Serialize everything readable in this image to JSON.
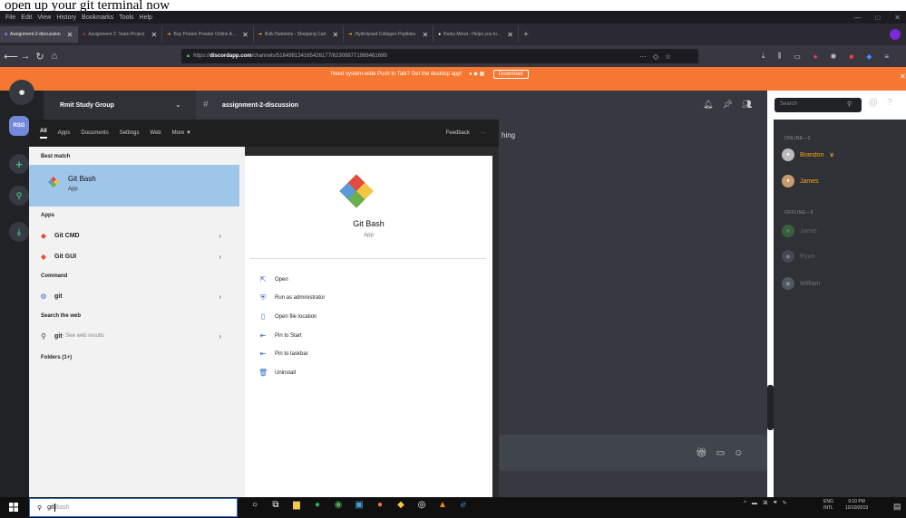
{
  "caption": "open up your git terminal now",
  "browser": {
    "menu": [
      "File",
      "Edit",
      "View",
      "History",
      "Bookmarks",
      "Tools",
      "Help"
    ],
    "tabs": [
      {
        "label": "Assignment-2-discussion",
        "active": true
      },
      {
        "label": "Assignment 2: Team Project"
      },
      {
        "label": "Buy Protein Powder Online A..."
      },
      {
        "label": "Bulk Nutrients - Shopping Cart"
      },
      {
        "label": "Hydrolysed Collagen Peptides"
      },
      {
        "label": "Rainy Mood - Helps you to..."
      }
    ],
    "url_prefix": "https://",
    "url_domain": "discordapp.com",
    "url_path": "/channels/516498134165426177/623098771988461699"
  },
  "discord": {
    "notice": "Need system-wide Push to Talk? Get the desktop app!",
    "notice_button": "Download",
    "server_name": "Rmit Study Group",
    "server_icon": "RSG",
    "channel_name": "assignment-2-discussion",
    "search_placeholder": "Search",
    "chat_snippet": "hing",
    "members_online_header": "ONLINE—2",
    "members_offline_header": "OFFLINE—3",
    "online": [
      {
        "name": "Brandon",
        "color": "#faa61a"
      },
      {
        "name": "James",
        "color": "#faa61a"
      }
    ],
    "offline": [
      {
        "name": "Jamie"
      },
      {
        "name": "Ryan"
      },
      {
        "name": "William"
      }
    ]
  },
  "start_menu": {
    "tabs": [
      "All",
      "Apps",
      "Documents",
      "Settings",
      "Web",
      "More ▼"
    ],
    "feedback": "Feedback",
    "more_dots": "···",
    "best_match_header": "Best match",
    "best_match": {
      "name": "Git Bash",
      "type": "App"
    },
    "apps_header": "Apps",
    "apps": [
      {
        "name": "Git CMD"
      },
      {
        "name": "Git GUI"
      }
    ],
    "command_header": "Command",
    "command": {
      "name": "git"
    },
    "web_header": "Search the web",
    "web": {
      "name": "git",
      "suffix": " - See web results"
    },
    "folders": "Folders (1+)",
    "detail": {
      "title": "Git Bash",
      "subtitle": "App"
    },
    "actions": [
      "Open",
      "Run as administrator",
      "Open file location",
      "Pin to Start",
      "Pin to taskbar",
      "Uninstall"
    ]
  },
  "taskbar": {
    "search_typed": "git",
    "search_completion": "Bash",
    "lang": [
      "ENG",
      "INTL"
    ],
    "time": "9:10 PM",
    "date": "10/10/2019"
  },
  "colors": {
    "discord_orange": "#f57731",
    "best_match_bg": "#9ec6e9",
    "accent": "#2f6dc6"
  }
}
